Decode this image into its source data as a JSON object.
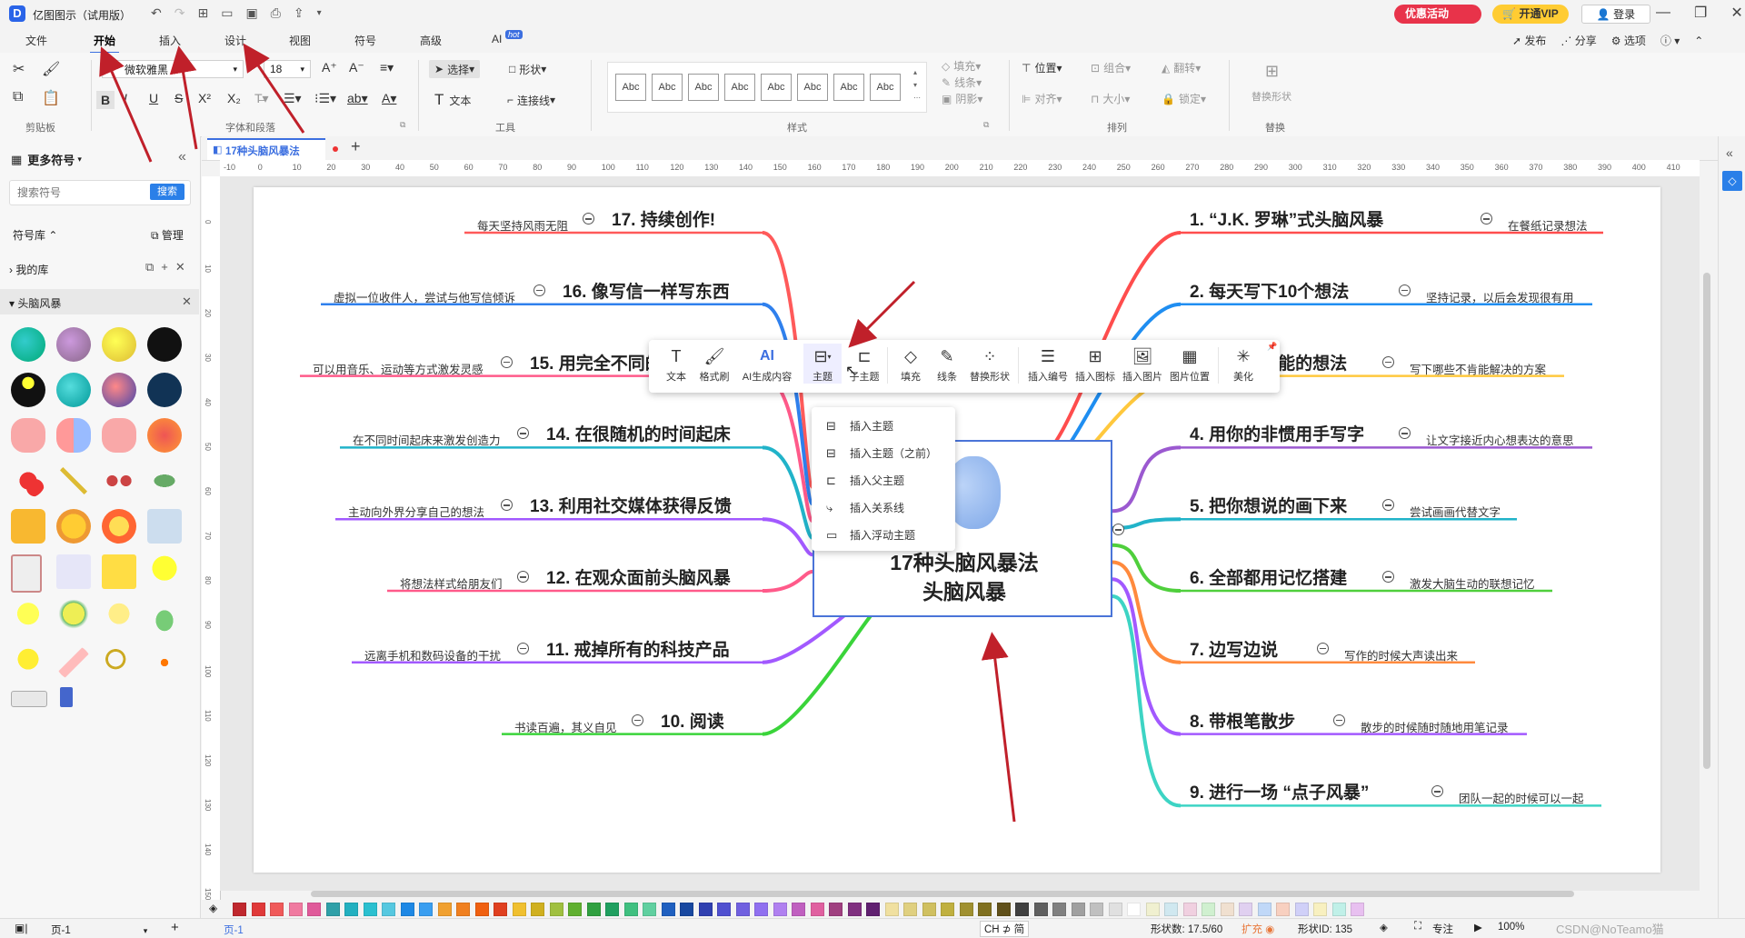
{
  "app": {
    "title": "亿图图示（试用版）",
    "promo_label": "优惠活动",
    "vip_label": "开通VIP",
    "login_label": "登录"
  },
  "menu": {
    "items": [
      "文件",
      "开始",
      "插入",
      "设计",
      "视图",
      "符号",
      "高级",
      "AI"
    ],
    "ai_badge": "hot",
    "right": [
      "发布",
      "分享",
      "选项"
    ]
  },
  "ribbon": {
    "font_name": "微软雅黑",
    "font_size": "18",
    "select_label": "选择",
    "shape_label": "形状",
    "text_label": "文本",
    "connector_label": "连接线",
    "fill_label": "填充",
    "line_label": "线条",
    "shadow_label": "阴影",
    "position_label": "位置",
    "group_label": "组合",
    "flip_label": "翻转",
    "align_label": "对齐",
    "size_label": "大小",
    "lock_label": "锁定",
    "replace_shape_label": "替换形状",
    "style_abc": [
      "Abc",
      "Abc",
      "Abc",
      "Abc",
      "Abc",
      "Abc",
      "Abc",
      "Abc"
    ],
    "group_titles": {
      "clipboard": "剪贴板",
      "font": "字体和段落",
      "tools": "工具",
      "styles": "样式",
      "arrange": "排列",
      "replace": "替换"
    }
  },
  "left_panel": {
    "header": "更多符号",
    "search_placeholder": "搜索符号",
    "search_button": "搜索",
    "library_label": "符号库",
    "manage_label": "管理",
    "my_library": "我的库",
    "category": "头脑风暴"
  },
  "tabs": {
    "doc_title": "17种头脑风暴法"
  },
  "ruler": {
    "top_ticks": [
      "-10",
      "0",
      "10",
      "20",
      "30",
      "40",
      "50",
      "60",
      "70",
      "80",
      "90",
      "100",
      "110",
      "120",
      "130",
      "140",
      "150",
      "160",
      "170",
      "180",
      "190",
      "200",
      "210",
      "220",
      "230",
      "240",
      "250",
      "260",
      "270",
      "280",
      "290",
      "300",
      "310",
      "320",
      "330",
      "340",
      "350",
      "360",
      "370",
      "380",
      "390",
      "400",
      "410"
    ],
    "left_ticks": [
      "0",
      "10",
      "20",
      "30",
      "40",
      "50",
      "60",
      "70",
      "80",
      "90",
      "100",
      "110",
      "120",
      "130",
      "140",
      "150"
    ]
  },
  "mindmap": {
    "center_line1": "17种头脑风暴法",
    "center_line2": "头脑风暴",
    "right_topics": [
      {
        "title": "1. “J.K. 罗琳”式头脑风暴",
        "note": "在餐纸记录想法",
        "color": "#ff4d4d"
      },
      {
        "title": "2. 每天写下10个想法",
        "note": "坚持记录，以后会发现很有用",
        "color": "#1f8ef1"
      },
      {
        "title": "3. 每个不可能的想法",
        "note": "写下哪些不肯能解决的方案",
        "color": "#ffc83d"
      },
      {
        "title": "4. 用你的非惯用手写字",
        "note": "让文字接近内心想表达的意思",
        "color": "#9b59d0"
      },
      {
        "title": "5. 把你想说的画下来",
        "note": "尝试画画代替文字",
        "color": "#21b3c9"
      },
      {
        "title": "6. 全部都用记忆搭建",
        "note": "激发大脑生动的联想记忆",
        "color": "#4fcf3c"
      },
      {
        "title": "7. 边写边说",
        "note": "写作的时候大声读出来",
        "color": "#ff8a3d"
      },
      {
        "title": "8. 带根笔散步",
        "note": "散步的时候随时随地用笔记录",
        "color": "#a259ff"
      },
      {
        "title": "9. 进行一场 “点子风暴”",
        "note": "团队一起的时候可以一起",
        "color": "#3dd4c4"
      }
    ],
    "left_topics": [
      {
        "title": "17. 持续创作!",
        "note": "每天坚持风雨无阻",
        "color": "#ff5a5a"
      },
      {
        "title": "16. 像写信一样写东西",
        "note": "虚拟一位收件人，尝试与他写信倾诉",
        "color": "#2f80ed"
      },
      {
        "title": "15. 用完全不同的方式创造",
        "note": "可以用音乐、运动等方式激发灵感",
        "color": "#ff5a8a"
      },
      {
        "title": "14. 在很随机的时间起床",
        "note": "在不同时间起床来激发创造力",
        "color": "#21b3c9"
      },
      {
        "title": "13. 利用社交媒体获得反馈",
        "note": "主动向外界分享自己的想法",
        "color": "#a259ff"
      },
      {
        "title": "12. 在观众面前头脑风暴",
        "note": "将想法样式给朋友们",
        "color": "#ff5a8a"
      },
      {
        "title": "11. 戒掉所有的科技产品",
        "note": "远离手机和数码设备的干扰",
        "color": "#a259ff"
      },
      {
        "title": "10. 阅读",
        "note": "书读百遍，其义自见",
        "color": "#3ad43a"
      }
    ]
  },
  "floating_toolbar": {
    "items": [
      "文本",
      "格式刷",
      "AI生成内容",
      "主题",
      "子主题",
      "填充",
      "线条",
      "替换形状",
      "插入编号",
      "插入图标",
      "插入图片",
      "图片位置",
      "美化"
    ]
  },
  "dropdown": {
    "items": [
      "插入主题",
      "插入主题（之前）",
      "插入父主题",
      "插入关系线",
      "插入浮动主题"
    ]
  },
  "statusbar": {
    "page_select": "页-1",
    "page_tab": "页-1",
    "ime": "CH ⊅ 简",
    "shape_count": "形状数: 17.5/60",
    "expand": "扩充",
    "shape_id": "形状ID: 135",
    "focus": "专注",
    "zoom": "100%",
    "watermark": "CSDN@NoTeamo猫"
  },
  "colors": {
    "accent": "#3c6fe0",
    "promo": "#e8334a",
    "vip": "#ffcc33",
    "arrow": "#c0202a",
    "center_border": "#4a74d8"
  },
  "palette": [
    "#c0282e",
    "#e03a3a",
    "#f05a5a",
    "#f07aa0",
    "#e05a9a",
    "#2fa0a8",
    "#23b0c0",
    "#2bc0d0",
    "#56c8e0",
    "#1e88e5",
    "#3a9ef0",
    "#f0a030",
    "#f08020",
    "#f06010",
    "#e04020",
    "#f0c030",
    "#d0b020",
    "#a0c040",
    "#60b030",
    "#30a040",
    "#20a060",
    "#40c080",
    "#60d0a0",
    "#2060c0",
    "#1848a0",
    "#3040b0",
    "#5050d0",
    "#7060e0",
    "#9070f0",
    "#b080f0",
    "#c060c0",
    "#e060a0",
    "#a04080",
    "#803080",
    "#602070",
    "#f0e0a0",
    "#e0d080",
    "#d0c060",
    "#c0b040",
    "#a09030",
    "#807020",
    "#60501a",
    "#404040",
    "#606060",
    "#808080",
    "#a0a0a0",
    "#c0c0c0",
    "#e0e0e0",
    "#ffffff",
    "#f0f0d0",
    "#d0e8f0",
    "#f0d0e0",
    "#d0f0d0",
    "#f0e0d0",
    "#e0d0f0",
    "#c0d8f8",
    "#f8d0c0",
    "#d0d0f8",
    "#f8f0c0",
    "#c0f0e8",
    "#e8c0f0"
  ]
}
